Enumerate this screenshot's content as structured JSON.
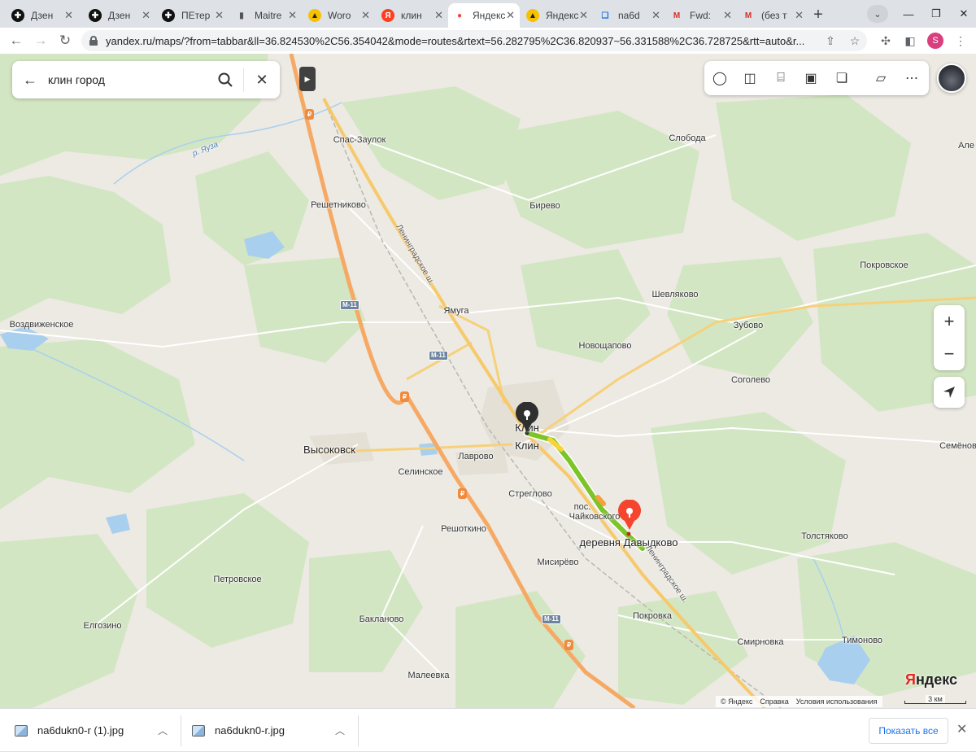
{
  "browser": {
    "tabs": [
      {
        "label": "Дзен",
        "icon": "zen-icon",
        "active": false
      },
      {
        "label": "Дзен",
        "icon": "zen-icon",
        "active": false
      },
      {
        "label": "ПЕтер",
        "icon": "zen-icon",
        "active": false
      },
      {
        "label": "Maitre",
        "icon": "signal-bars-icon",
        "active": false
      },
      {
        "label": "Woro",
        "icon": "image-icon",
        "active": false
      },
      {
        "label": "клин",
        "icon": "yandex-icon",
        "active": false
      },
      {
        "label": "Яндекс",
        "icon": "map-pin-icon",
        "active": true
      },
      {
        "label": "Яндекс",
        "icon": "image-icon",
        "active": false
      },
      {
        "label": "na6d",
        "icon": "book-icon",
        "active": false
      },
      {
        "label": "Fwd:",
        "icon": "gmail-icon",
        "active": false
      },
      {
        "label": "(без т",
        "icon": "gmail-icon",
        "active": false
      }
    ],
    "new_tab": "+",
    "address": "yandex.ru/maps/?from=tabbar&ll=36.824530%2C56.354042&mode=routes&rtext=56.282795%2C36.820937~56.331588%2C36.728725&rtt=auto&r...",
    "profile_initial": "S"
  },
  "search": {
    "query": "клин город"
  },
  "map": {
    "places": [
      {
        "name": "Спас-Заулок"
      },
      {
        "name": "Слобода"
      },
      {
        "name": "Решетниково"
      },
      {
        "name": "Бирево"
      },
      {
        "name": "Покровское"
      },
      {
        "name": "Шевляково"
      },
      {
        "name": "Ямуга"
      },
      {
        "name": "Воздвиженское"
      },
      {
        "name": "Зубово"
      },
      {
        "name": "Новощапово"
      },
      {
        "name": "Соголево"
      },
      {
        "name": "Клин"
      },
      {
        "name": "Клин"
      },
      {
        "name": "Высоковск"
      },
      {
        "name": "Лаврово"
      },
      {
        "name": "Селинское"
      },
      {
        "name": "Стреглово"
      },
      {
        "name": "пос."
      },
      {
        "name": "Чайковского"
      },
      {
        "name": "Семёнов"
      },
      {
        "name": "деревня Давыдково"
      },
      {
        "name": "Толстяково"
      },
      {
        "name": "Решоткино"
      },
      {
        "name": "Мисирёво"
      },
      {
        "name": "Петровское"
      },
      {
        "name": "Елгозино"
      },
      {
        "name": "Покровка"
      },
      {
        "name": "Бакланово"
      },
      {
        "name": "Смирновка"
      },
      {
        "name": "Тимоново"
      },
      {
        "name": "Малеевка"
      },
      {
        "name": "Але"
      }
    ],
    "rivers": [
      "р. Яуза"
    ],
    "road_names": [
      "Ленинградское ш.",
      "Ленинградское ш."
    ],
    "road_shields": [
      "М-11",
      "М-11",
      "М-11"
    ],
    "fuel_marker": "₽",
    "route": {
      "start": "Клин",
      "end": "деревня Давыдково"
    },
    "colors": {
      "route_green": "#7dc428",
      "route_yellow": "#f5d63a",
      "pin_start": "#2f2f2f",
      "pin_end": "#f5452f",
      "highway": "#f6a964"
    },
    "logo": "Яндекс",
    "copyright": [
      "© Яндекс",
      "Справка",
      "Условия использования"
    ],
    "scale_text": "3 км"
  },
  "downloads": {
    "items": [
      {
        "name": "na6dukn0-r (1).jpg"
      },
      {
        "name": "na6dukn0-r.jpg"
      }
    ],
    "show_all": "Показать все"
  }
}
